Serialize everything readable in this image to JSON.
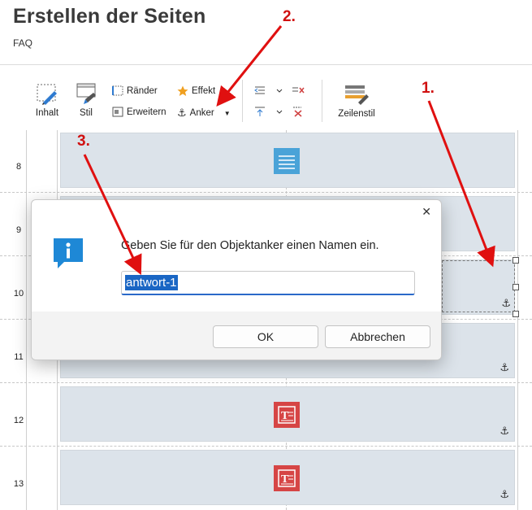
{
  "page": {
    "title": "Erstellen der Seiten",
    "subtitle": "FAQ"
  },
  "toolbar": {
    "inhalt": "Inhalt",
    "stil": "Stil",
    "raender": "Ränder",
    "erweitern": "Erweitern",
    "effekt": "Effekt",
    "anker": "Anker",
    "zeilenstil": "Zeilenstil"
  },
  "rows": [
    {
      "num": "8"
    },
    {
      "num": "9"
    },
    {
      "num": "10"
    },
    {
      "num": "11"
    },
    {
      "num": "12"
    },
    {
      "num": "13"
    }
  ],
  "dialog": {
    "message": "Geben Sie für den Objektanker einen Namen ein.",
    "input_value": "antwort-1",
    "ok_label": "OK",
    "cancel_label": "Abbrechen",
    "close_glyph": "✕"
  },
  "annotations": {
    "one": "1.",
    "two": "2.",
    "three": "3."
  },
  "colors": {
    "accent": "#1a66c4",
    "arrow": "#e01010",
    "cell": "#dce3ea",
    "info": "#1e88d6",
    "text_block": "#d64545"
  }
}
